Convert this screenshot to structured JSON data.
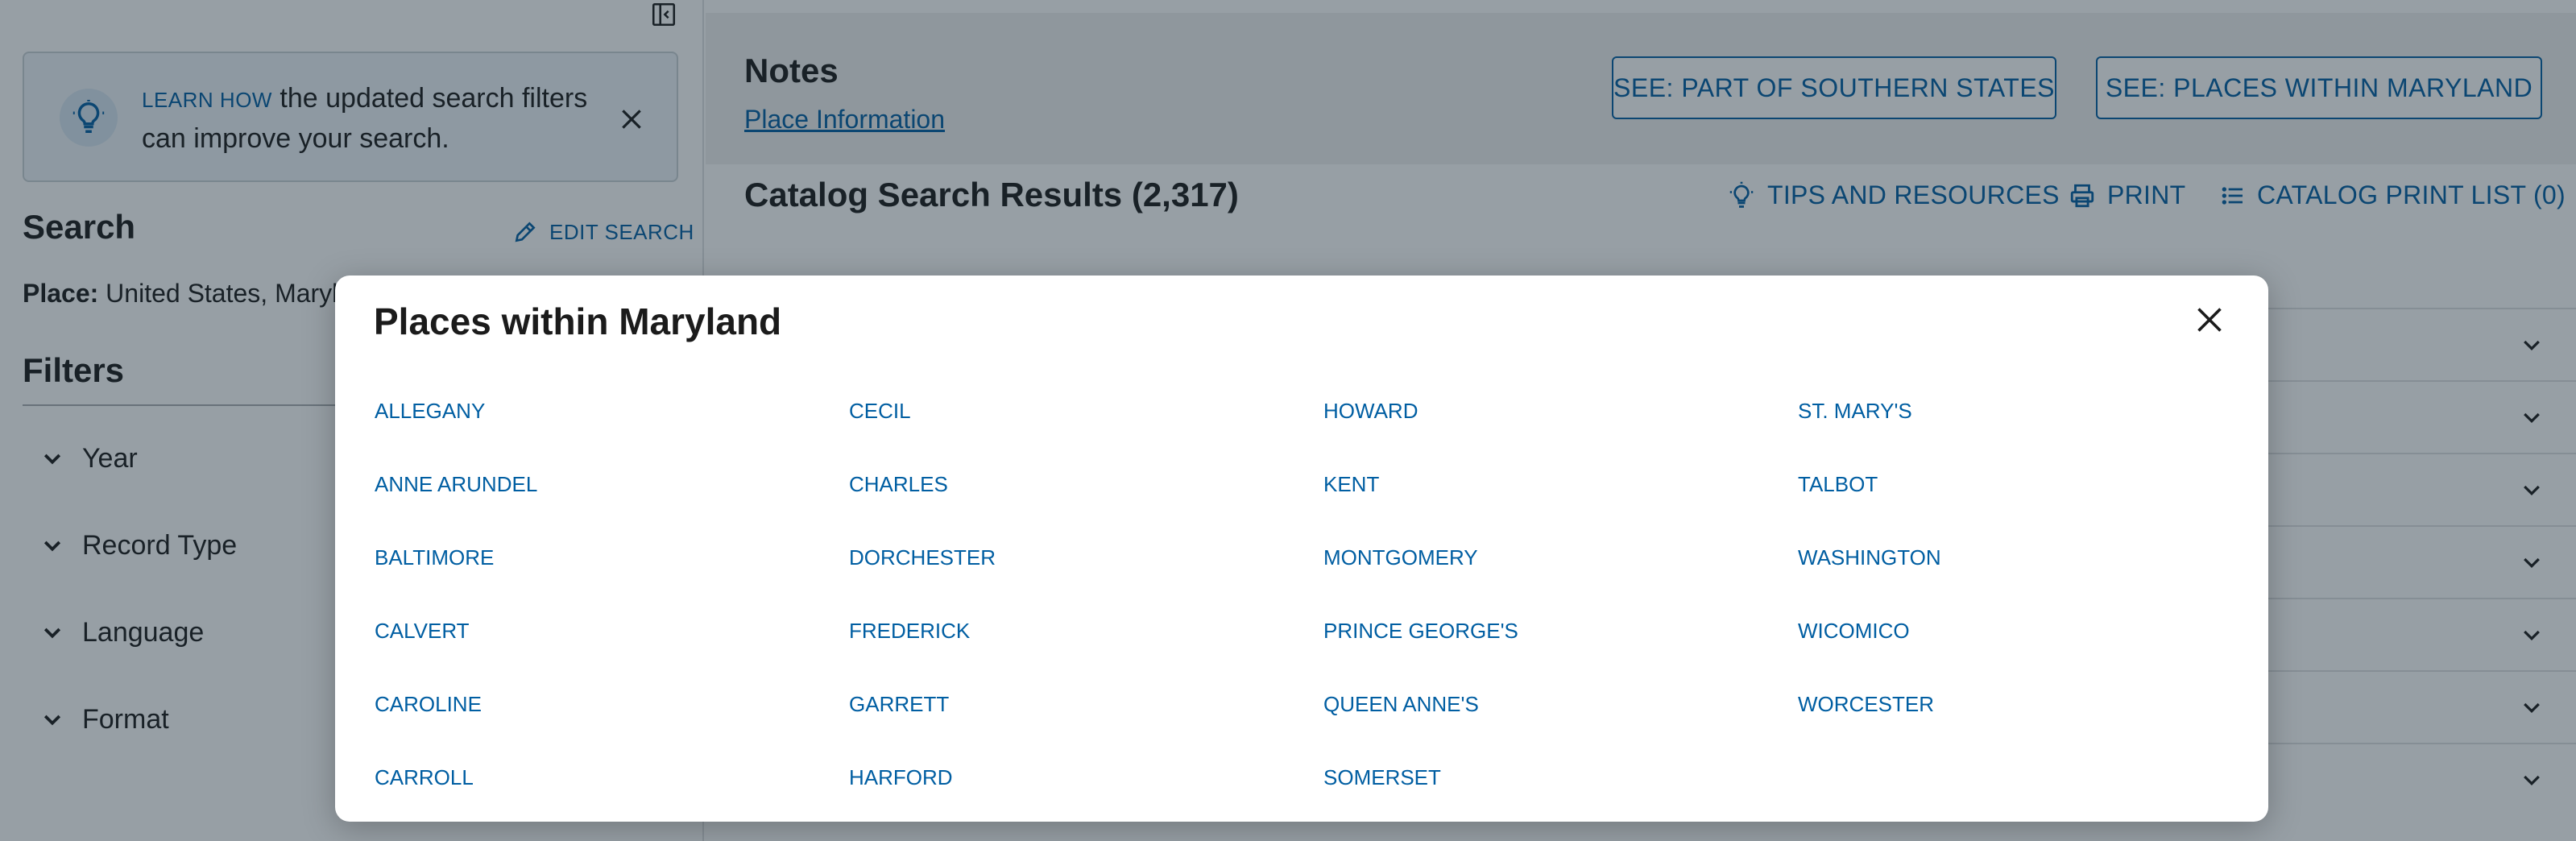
{
  "sidebar": {
    "tip": {
      "learn_how": "LEARN HOW",
      "text": " the updated search filters can improve your search."
    },
    "search_heading": "Search",
    "edit_search": "EDIT SEARCH",
    "place_label": "Place:",
    "place_value": " United States, Maryland",
    "filters_heading": "Filters",
    "filters": [
      "Year",
      "Record Type",
      "Language",
      "Format"
    ]
  },
  "main": {
    "notes_title": "Notes",
    "place_info_link": "Place Information",
    "see_buttons": [
      "SEE: PART OF SOUTHERN STATES",
      "SEE: PLACES WITHIN MARYLAND"
    ],
    "results_title": "Catalog Search Results (2,317)",
    "tools": {
      "tips": "TIPS AND RESOURCES",
      "print": "PRINT",
      "print_list": "CATALOG PRINT LIST (0)"
    }
  },
  "modal": {
    "title": "Places within Maryland",
    "places": [
      [
        "ALLEGANY",
        "CECIL",
        "HOWARD",
        "ST. MARY'S"
      ],
      [
        "ANNE ARUNDEL",
        "CHARLES",
        "KENT",
        "TALBOT"
      ],
      [
        "BALTIMORE",
        "DORCHESTER",
        "MONTGOMERY",
        "WASHINGTON"
      ],
      [
        "CALVERT",
        "FREDERICK",
        "PRINCE GEORGE'S",
        "WICOMICO"
      ],
      [
        "CAROLINE",
        "GARRETT",
        "QUEEN ANNE'S",
        "WORCESTER"
      ],
      [
        "CARROLL",
        "HARFORD",
        "SOMERSET",
        ""
      ]
    ]
  },
  "colors": {
    "link": "#005ea2",
    "overlay": "#182a38"
  }
}
